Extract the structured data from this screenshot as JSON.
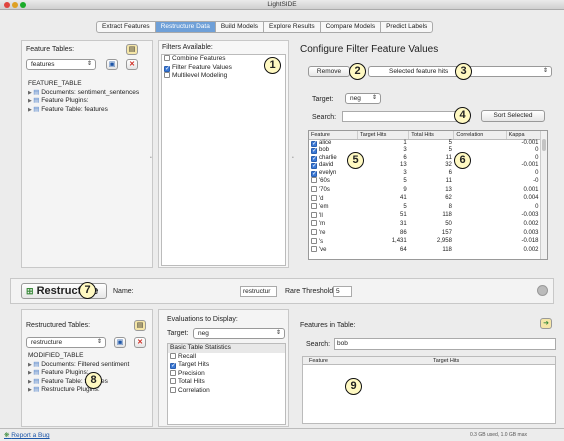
{
  "window": {
    "title": "LightSIDE"
  },
  "tabs": [
    "Extract Features",
    "Restructure Data",
    "Build Models",
    "Explore Results",
    "Compare Models",
    "Predict Labels"
  ],
  "active_tab": 1,
  "left": {
    "label": "Feature Tables:",
    "select": "features",
    "tree": [
      "FEATURE_TABLE",
      "Documents: sentiment_sentences",
      "Feature Plugins:",
      "Feature Table: features"
    ]
  },
  "filters": {
    "label": "Filters Available:",
    "items": [
      {
        "label": "Combine Features",
        "checked": false
      },
      {
        "label": "Filter Feature Values",
        "checked": true
      },
      {
        "label": "Multilevel Modeling",
        "checked": false
      }
    ]
  },
  "config": {
    "title": "Configure Filter Feature Values",
    "remove_label": "Remove",
    "hits_select": "Selected feature hits",
    "target_label": "Target:",
    "target_value": "neg",
    "search_label": "Search:",
    "search_value": "",
    "sort_label": "Sort Selected",
    "columns": [
      "Feature",
      "Target Hits",
      "Total Hits",
      "Correlation",
      "Kappa"
    ],
    "rows": [
      {
        "f": "alice",
        "th": "1",
        "to": "5",
        "c": "",
        "k": "-0.001",
        "chk": true
      },
      {
        "f": "bob",
        "th": "3",
        "to": "5",
        "c": "",
        "k": "0",
        "chk": true
      },
      {
        "f": "charlie",
        "th": "6",
        "to": "11",
        "c": "",
        "k": "0",
        "chk": true
      },
      {
        "f": "david",
        "th": "13",
        "to": "32",
        "c": "",
        "k": "-0.001",
        "chk": true
      },
      {
        "f": "evelyn",
        "th": "3",
        "to": "6",
        "c": "",
        "k": "0",
        "chk": true
      },
      {
        "f": "'60s",
        "th": "5",
        "to": "11",
        "c": "",
        "k": "-0",
        "chk": false
      },
      {
        "f": "'70s",
        "th": "9",
        "to": "13",
        "c": "",
        "k": "0.001",
        "chk": false
      },
      {
        "f": "'d",
        "th": "41",
        "to": "62",
        "c": "",
        "k": "0.004",
        "chk": false
      },
      {
        "f": "'em",
        "th": "5",
        "to": "8",
        "c": "",
        "k": "0",
        "chk": false
      },
      {
        "f": "'ll",
        "th": "51",
        "to": "118",
        "c": "",
        "k": "-0.003",
        "chk": false
      },
      {
        "f": "'m",
        "th": "31",
        "to": "50",
        "c": "",
        "k": "0.002",
        "chk": false
      },
      {
        "f": "'re",
        "th": "86",
        "to": "157",
        "c": "",
        "k": "0.003",
        "chk": false
      },
      {
        "f": "'s",
        "th": "1,431",
        "to": "2,958",
        "c": "",
        "k": "-0.018",
        "chk": false
      },
      {
        "f": "'ve",
        "th": "64",
        "to": "118",
        "c": "",
        "k": "0.002",
        "chk": false
      }
    ]
  },
  "restructure": {
    "button": "Restructure",
    "name_label": "Name:",
    "name_value": "restructur",
    "threshold_label": "Rare Threshold:",
    "threshold_value": "5"
  },
  "bottom_left": {
    "label": "Restructured Tables:",
    "select": "restructure",
    "tree": [
      "MODIFIED_TABLE",
      "Documents: Filtered sentiment",
      "Feature Plugins:",
      "Feature Table: features",
      "Restructure Plugins:"
    ]
  },
  "evals": {
    "label": "Evaluations to Display:",
    "target_label": "Target:",
    "target_value": "neg",
    "header": "Basic Table Statistics",
    "items": [
      {
        "label": "Recall",
        "checked": false
      },
      {
        "label": "Target Hits",
        "checked": true
      },
      {
        "label": "Precision",
        "checked": false
      },
      {
        "label": "Total Hits",
        "checked": false
      },
      {
        "label": "Correlation",
        "checked": false
      }
    ]
  },
  "features_in_table": {
    "label": "Features in Table:",
    "search_label": "Search:",
    "search_value": "bob",
    "columns": [
      "Feature",
      "Target Hits"
    ]
  },
  "footer": {
    "report": "Report a Bug",
    "memory": "0.3 GB used, 1.0 GB max"
  },
  "callouts": [
    "1",
    "2",
    "3",
    "4",
    "5",
    "6",
    "7",
    "8",
    "9"
  ]
}
